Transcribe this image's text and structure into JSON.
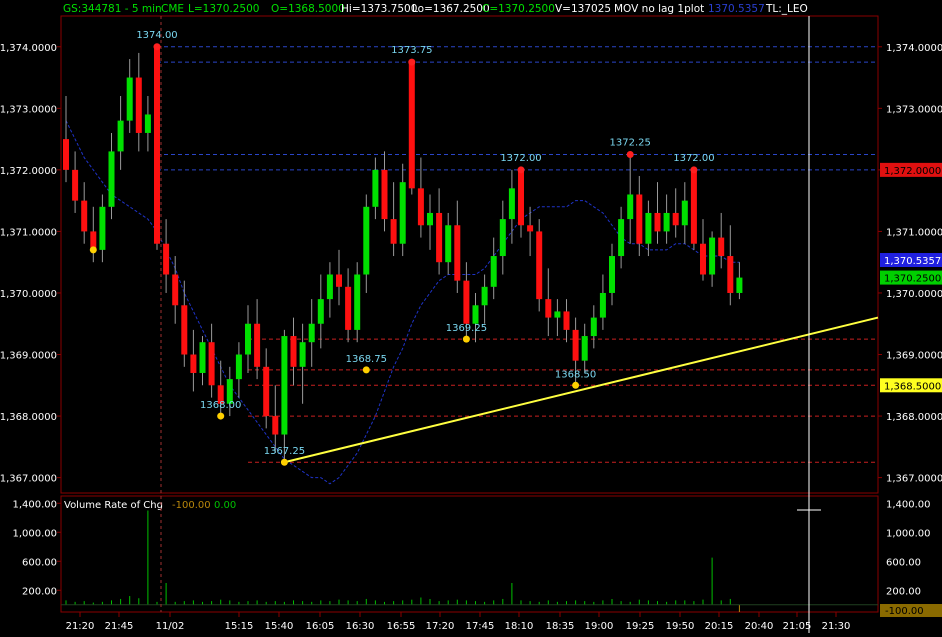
{
  "header": {
    "symbol": "GS:344781 - 5 min",
    "exchange": "CME",
    "last": "L=1370.2500",
    "open": "O=1368.5000",
    "high": "Hi=1373.7500",
    "low": "Lo=1367.2500",
    "close": "C=1370.2500",
    "volume": "V=137025",
    "indicator": "MOV no lag 1plot",
    "indicator_value": "1370.5357",
    "template": "TL:_LEO"
  },
  "volume_panel": {
    "title": "Volume Rate of Chg",
    "value1": "-100.00",
    "value2": "0.00",
    "badge": "-100.00"
  },
  "price_badges": {
    "level_a": "1,372.0000",
    "indicator": "1,370.5357",
    "last": "1,370.2500",
    "level_b": "1,368.5000"
  },
  "colors": {
    "up": "#00e000",
    "down": "#ff1010",
    "ma": "#1f33c8",
    "trend": "#ffff40",
    "label": "#7ad7f0",
    "level_hi": "#2a45c8",
    "level_lo": "#c82020"
  },
  "chart_data": {
    "type": "candlestick",
    "ylim": [
      1366.75,
      1374.5
    ],
    "y_ticks": [
      "1,374.0000",
      "1,373.0000",
      "1,372.0000",
      "1,371.0000",
      "1,370.0000",
      "1,369.0000",
      "1,368.0000",
      "1,367.0000"
    ],
    "vol_ticks": [
      "1,400.00",
      "1,000.00",
      "600.00",
      "200.00"
    ],
    "vol_ylim": [
      -100,
      1500
    ],
    "x_tick_labels": [
      "21:20",
      "21:45",
      "11/02",
      "15:15",
      "15:40",
      "16:05",
      "16:30",
      "16:55",
      "17:20",
      "17:45",
      "18:10",
      "18:35",
      "19:00",
      "19:25",
      "19:50",
      "20:15",
      "20:40",
      "21:05",
      "21:30"
    ],
    "candles": [
      {
        "o": 1372.5,
        "h": 1373.2,
        "l": 1371.8,
        "c": 1372.0
      },
      {
        "o": 1372.0,
        "h": 1372.3,
        "l": 1371.3,
        "c": 1371.5
      },
      {
        "o": 1371.5,
        "h": 1371.8,
        "l": 1370.8,
        "c": 1371.0
      },
      {
        "o": 1371.0,
        "h": 1371.4,
        "l": 1370.5,
        "c": 1370.7
      },
      {
        "o": 1370.7,
        "h": 1371.6,
        "l": 1370.5,
        "c": 1371.4
      },
      {
        "o": 1371.4,
        "h": 1372.6,
        "l": 1371.2,
        "c": 1372.3
      },
      {
        "o": 1372.3,
        "h": 1373.2,
        "l": 1372.0,
        "c": 1372.8
      },
      {
        "o": 1372.8,
        "h": 1373.8,
        "l": 1372.6,
        "c": 1373.5
      },
      {
        "o": 1373.5,
        "h": 1373.9,
        "l": 1372.3,
        "c": 1372.6
      },
      {
        "o": 1372.6,
        "h": 1373.2,
        "l": 1372.3,
        "c": 1372.9
      },
      {
        "o": 1374.0,
        "h": 1374.0,
        "l": 1370.7,
        "c": 1370.8
      },
      {
        "o": 1370.8,
        "h": 1371.2,
        "l": 1370.0,
        "c": 1370.3
      },
      {
        "o": 1370.3,
        "h": 1370.6,
        "l": 1369.5,
        "c": 1369.8
      },
      {
        "o": 1369.8,
        "h": 1370.2,
        "l": 1368.8,
        "c": 1369.0
      },
      {
        "o": 1369.0,
        "h": 1369.4,
        "l": 1368.4,
        "c": 1368.7
      },
      {
        "o": 1368.7,
        "h": 1369.3,
        "l": 1368.5,
        "c": 1369.2
      },
      {
        "o": 1369.2,
        "h": 1369.5,
        "l": 1368.3,
        "c": 1368.5
      },
      {
        "o": 1368.5,
        "h": 1368.9,
        "l": 1368.0,
        "c": 1368.2
      },
      {
        "o": 1368.2,
        "h": 1368.8,
        "l": 1368.0,
        "c": 1368.6
      },
      {
        "o": 1368.6,
        "h": 1369.2,
        "l": 1368.3,
        "c": 1369.0
      },
      {
        "o": 1369.0,
        "h": 1369.8,
        "l": 1368.7,
        "c": 1369.5
      },
      {
        "o": 1369.5,
        "h": 1369.9,
        "l": 1368.6,
        "c": 1368.8
      },
      {
        "o": 1368.8,
        "h": 1369.1,
        "l": 1367.8,
        "c": 1368.0
      },
      {
        "o": 1368.0,
        "h": 1368.5,
        "l": 1367.4,
        "c": 1367.7
      },
      {
        "o": 1367.7,
        "h": 1369.4,
        "l": 1367.25,
        "c": 1369.3
      },
      {
        "o": 1369.3,
        "h": 1369.6,
        "l": 1368.5,
        "c": 1368.8
      },
      {
        "o": 1368.8,
        "h": 1369.5,
        "l": 1368.2,
        "c": 1369.2
      },
      {
        "o": 1369.2,
        "h": 1369.9,
        "l": 1368.8,
        "c": 1369.5
      },
      {
        "o": 1369.5,
        "h": 1370.3,
        "l": 1369.1,
        "c": 1369.9
      },
      {
        "o": 1369.9,
        "h": 1370.5,
        "l": 1369.6,
        "c": 1370.3
      },
      {
        "o": 1370.3,
        "h": 1370.7,
        "l": 1369.8,
        "c": 1370.1
      },
      {
        "o": 1370.1,
        "h": 1370.4,
        "l": 1369.2,
        "c": 1369.4
      },
      {
        "o": 1369.4,
        "h": 1370.5,
        "l": 1369.2,
        "c": 1370.3
      },
      {
        "o": 1370.3,
        "h": 1371.6,
        "l": 1370.0,
        "c": 1371.4
      },
      {
        "o": 1371.4,
        "h": 1372.2,
        "l": 1371.2,
        "c": 1372.0
      },
      {
        "o": 1372.0,
        "h": 1372.3,
        "l": 1371.0,
        "c": 1371.2
      },
      {
        "o": 1371.2,
        "h": 1371.8,
        "l": 1370.6,
        "c": 1370.8
      },
      {
        "o": 1370.8,
        "h": 1372.1,
        "l": 1370.6,
        "c": 1371.8
      },
      {
        "o": 1373.75,
        "h": 1373.75,
        "l": 1371.6,
        "c": 1371.7
      },
      {
        "o": 1371.7,
        "h": 1372.2,
        "l": 1370.9,
        "c": 1371.1
      },
      {
        "o": 1371.1,
        "h": 1371.6,
        "l": 1370.7,
        "c": 1371.3
      },
      {
        "o": 1371.3,
        "h": 1371.7,
        "l": 1370.3,
        "c": 1370.5
      },
      {
        "o": 1370.5,
        "h": 1371.3,
        "l": 1370.3,
        "c": 1371.1
      },
      {
        "o": 1371.1,
        "h": 1371.5,
        "l": 1370.0,
        "c": 1370.2
      },
      {
        "o": 1370.2,
        "h": 1370.5,
        "l": 1369.3,
        "c": 1369.5
      },
      {
        "o": 1369.5,
        "h": 1370.0,
        "l": 1369.2,
        "c": 1369.8
      },
      {
        "o": 1369.8,
        "h": 1370.3,
        "l": 1369.5,
        "c": 1370.1
      },
      {
        "o": 1370.1,
        "h": 1370.9,
        "l": 1369.9,
        "c": 1370.6
      },
      {
        "o": 1370.6,
        "h": 1371.5,
        "l": 1370.3,
        "c": 1371.2
      },
      {
        "o": 1371.2,
        "h": 1372.0,
        "l": 1370.8,
        "c": 1371.7
      },
      {
        "o": 1372.0,
        "h": 1372.0,
        "l": 1370.9,
        "c": 1371.1
      },
      {
        "o": 1371.1,
        "h": 1371.4,
        "l": 1370.6,
        "c": 1371.0
      },
      {
        "o": 1371.0,
        "h": 1371.2,
        "l": 1369.7,
        "c": 1369.9
      },
      {
        "o": 1369.9,
        "h": 1370.4,
        "l": 1369.3,
        "c": 1369.6
      },
      {
        "o": 1369.6,
        "h": 1369.9,
        "l": 1369.3,
        "c": 1369.7
      },
      {
        "o": 1369.7,
        "h": 1369.9,
        "l": 1369.2,
        "c": 1369.4
      },
      {
        "o": 1369.4,
        "h": 1369.6,
        "l": 1368.5,
        "c": 1368.9
      },
      {
        "o": 1368.9,
        "h": 1369.5,
        "l": 1368.7,
        "c": 1369.3
      },
      {
        "o": 1369.3,
        "h": 1369.8,
        "l": 1369.1,
        "c": 1369.6
      },
      {
        "o": 1369.6,
        "h": 1370.3,
        "l": 1369.4,
        "c": 1370.0
      },
      {
        "o": 1370.0,
        "h": 1370.8,
        "l": 1369.8,
        "c": 1370.6
      },
      {
        "o": 1370.6,
        "h": 1371.4,
        "l": 1370.4,
        "c": 1371.2
      },
      {
        "o": 1371.2,
        "h": 1372.25,
        "l": 1370.8,
        "c": 1371.6
      },
      {
        "o": 1371.6,
        "h": 1371.9,
        "l": 1370.6,
        "c": 1370.8
      },
      {
        "o": 1370.8,
        "h": 1371.5,
        "l": 1370.6,
        "c": 1371.3
      },
      {
        "o": 1371.3,
        "h": 1371.8,
        "l": 1370.8,
        "c": 1371.0
      },
      {
        "o": 1371.0,
        "h": 1371.6,
        "l": 1370.8,
        "c": 1371.3
      },
      {
        "o": 1371.3,
        "h": 1371.7,
        "l": 1370.9,
        "c": 1371.1
      },
      {
        "o": 1371.1,
        "h": 1371.8,
        "l": 1370.8,
        "c": 1371.5
      },
      {
        "o": 1372.0,
        "h": 1372.0,
        "l": 1370.7,
        "c": 1370.8
      },
      {
        "o": 1370.8,
        "h": 1371.2,
        "l": 1370.2,
        "c": 1370.3
      },
      {
        "o": 1370.3,
        "h": 1371.0,
        "l": 1370.1,
        "c": 1370.9
      },
      {
        "o": 1370.9,
        "h": 1371.3,
        "l": 1370.4,
        "c": 1370.6
      },
      {
        "o": 1370.6,
        "h": 1371.1,
        "l": 1369.8,
        "c": 1370.0
      },
      {
        "o": 1370.0,
        "h": 1370.5,
        "l": 1369.9,
        "c": 1370.25
      }
    ],
    "moving_average": [
      1372.8,
      1372.5,
      1372.2,
      1372.0,
      1371.8,
      1371.6,
      1371.5,
      1371.4,
      1371.3,
      1371.2,
      1371.0,
      1370.7,
      1370.4,
      1370.0,
      1369.7,
      1369.4,
      1369.1,
      1368.8,
      1368.5,
      1368.3,
      1368.1,
      1367.9,
      1367.7,
      1367.5,
      1367.3,
      1367.2,
      1367.1,
      1367.0,
      1367.0,
      1366.9,
      1367.0,
      1367.2,
      1367.4,
      1367.7,
      1368.0,
      1368.4,
      1368.8,
      1369.1,
      1369.5,
      1369.8,
      1370.0,
      1370.2,
      1370.3,
      1370.3,
      1370.3,
      1370.3,
      1370.4,
      1370.6,
      1370.8,
      1371.0,
      1371.2,
      1371.3,
      1371.4,
      1371.4,
      1371.4,
      1371.4,
      1371.5,
      1371.5,
      1371.4,
      1371.3,
      1371.1,
      1370.9,
      1370.8,
      1370.8,
      1370.7,
      1370.7,
      1370.7,
      1370.8,
      1370.8,
      1370.7,
      1370.6,
      1370.6,
      1370.6,
      1370.5,
      1370.5
    ],
    "peak_labels": [
      {
        "i": 10,
        "value": 1374.0,
        "text": "1374.00"
      },
      {
        "i": 38,
        "value": 1373.75,
        "text": "1373.75"
      },
      {
        "i": 50,
        "value": 1372.0,
        "text": "1372.00"
      },
      {
        "i": 62,
        "value": 1372.25,
        "text": "1372.25"
      },
      {
        "i": 69,
        "value": 1372.0,
        "text": "1372.00"
      }
    ],
    "trough_labels": [
      {
        "i": 3,
        "value": 1370.7,
        "text": ""
      },
      {
        "i": 17,
        "value": 1368.0,
        "text": "1368.00"
      },
      {
        "i": 24,
        "value": 1367.25,
        "text": "1367.25"
      },
      {
        "i": 33,
        "value": 1368.75,
        "text": "1368.75"
      },
      {
        "i": 44,
        "value": 1369.25,
        "text": "1369.25"
      },
      {
        "i": 56,
        "value": 1368.5,
        "text": "1368.50"
      }
    ],
    "hi_levels": [
      1374.0,
      1373.75,
      1372.25,
      1372.0
    ],
    "lo_levels": [
      1369.25,
      1368.75,
      1368.5,
      1368.0,
      1367.25
    ],
    "trendline": {
      "i_start": 24,
      "v_start": 1367.25,
      "i_end": 83,
      "v_end": 1369.6
    },
    "volume_roc": [
      60,
      40,
      50,
      30,
      40,
      60,
      80,
      120,
      90,
      1300,
      40,
      300,
      40,
      50,
      60,
      40,
      50,
      70,
      60,
      40,
      50,
      60,
      40,
      50,
      40,
      60,
      50,
      40,
      60,
      50,
      70,
      60,
      50,
      80,
      60,
      40,
      50,
      60,
      70,
      100,
      80,
      50,
      60,
      70,
      60,
      50,
      40,
      60,
      80,
      300,
      60,
      50,
      40,
      60,
      40,
      50,
      60,
      50,
      40,
      60,
      80,
      50,
      40,
      70,
      60,
      50,
      40,
      60,
      60,
      50,
      70,
      650,
      60,
      80,
      -100
    ]
  }
}
